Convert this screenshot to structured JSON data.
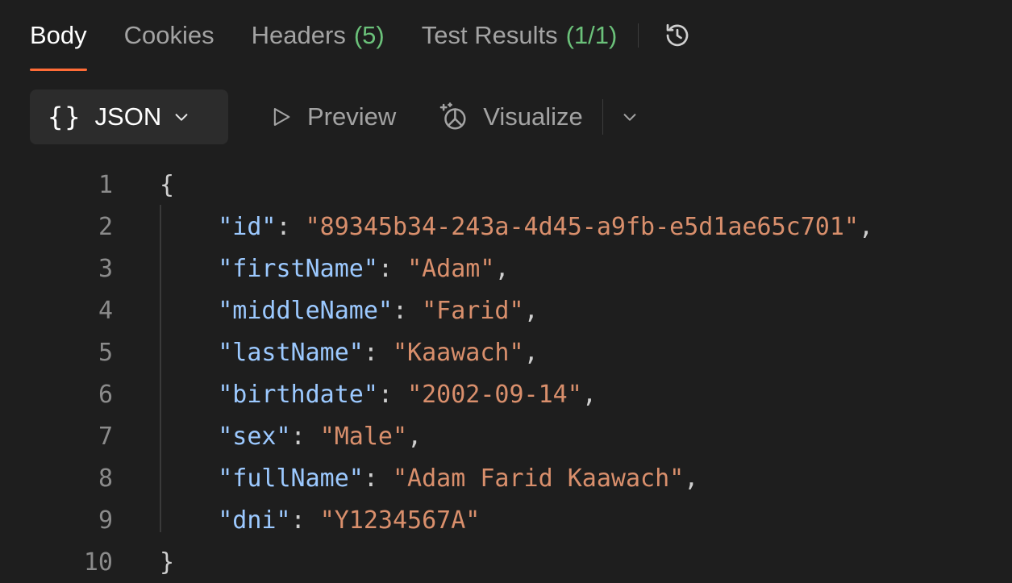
{
  "tabs": [
    {
      "label": "Body",
      "count": ""
    },
    {
      "label": "Cookies",
      "count": ""
    },
    {
      "label": "Headers",
      "count": "(5)"
    },
    {
      "label": "Test Results",
      "count": "(1/1)"
    }
  ],
  "toolbar": {
    "format_braces": "{}",
    "format_label": "JSON",
    "preview_label": "Preview",
    "visualize_label": "Visualize"
  },
  "colors": {
    "accent": "#ff6c37",
    "count": "#6bc17a",
    "key": "#9cc9ff",
    "string": "#d98f6c"
  },
  "editor": {
    "lines": [
      {
        "n": "1",
        "open": "{"
      },
      {
        "n": "2",
        "key": "\"id\"",
        "value": "\"89345b34-243a-4d45-a9fb-e5d1ae65c701\"",
        "tail": ","
      },
      {
        "n": "3",
        "key": "\"firstName\"",
        "value": "\"Adam\"",
        "tail": ","
      },
      {
        "n": "4",
        "key": "\"middleName\"",
        "value": "\"Farid\"",
        "tail": ","
      },
      {
        "n": "5",
        "key": "\"lastName\"",
        "value": "\"Kaawach\"",
        "tail": ","
      },
      {
        "n": "6",
        "key": "\"birthdate\"",
        "value": "\"2002-09-14\"",
        "tail": ","
      },
      {
        "n": "7",
        "key": "\"sex\"",
        "value": "\"Male\"",
        "tail": ","
      },
      {
        "n": "8",
        "key": "\"fullName\"",
        "value": "\"Adam Farid Kaawach\"",
        "tail": ","
      },
      {
        "n": "9",
        "key": "\"dni\"",
        "value": "\"Y1234567A\"",
        "tail": ""
      },
      {
        "n": "10",
        "close": "}"
      }
    ]
  }
}
